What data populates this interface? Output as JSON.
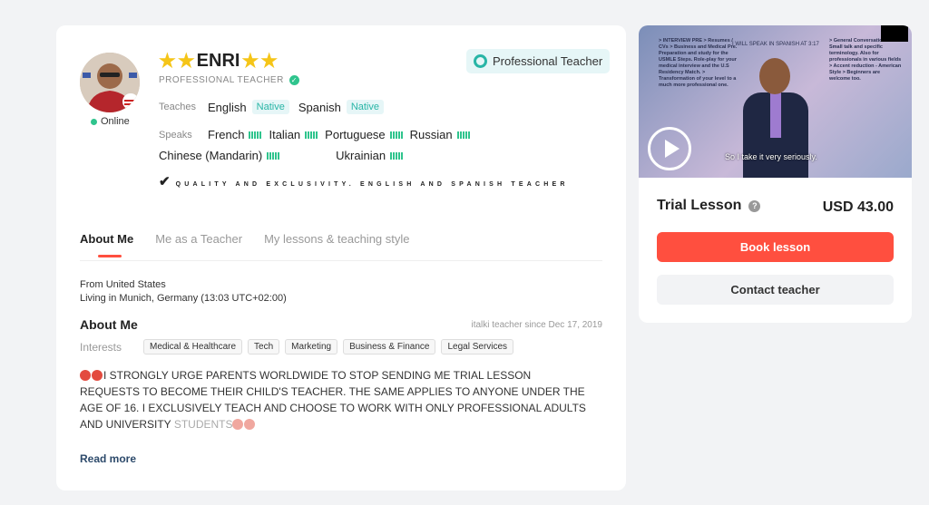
{
  "teacher": {
    "name": "ENRI",
    "role": "PROFESSIONAL TEACHER",
    "status": "Online",
    "badge": "Professional Teacher",
    "tagline": "QUALITY AND EXCLUSIVITY. ENGLISH AND SPANISH TEACHER"
  },
  "teaches": {
    "label": "Teaches",
    "languages": [
      {
        "name": "English",
        "level": "Native"
      },
      {
        "name": "Spanish",
        "level": "Native"
      }
    ]
  },
  "speaks": {
    "label": "Speaks",
    "languages": [
      "French",
      "Italian",
      "Portuguese",
      "Russian",
      "Chinese (Mandarin)",
      "Ukrainian"
    ]
  },
  "tabs": [
    "About Me",
    "Me as a Teacher",
    "My lessons & teaching style"
  ],
  "about": {
    "from": "From United States",
    "living": "Living in Munich, Germany (13:03 UTC+02:00)",
    "title": "About Me",
    "since": "italki teacher since Dec 17, 2019",
    "interests_label": "Interests",
    "interests": [
      "Medical & Healthcare",
      "Tech",
      "Marketing",
      "Business & Finance",
      "Legal Services"
    ],
    "bio": "I STRONGLY URGE PARENTS WORLDWIDE TO STOP SENDING ME TRIAL LESSON REQUESTS TO BECOME THEIR CHILD'S TEACHER. THE SAME APPLIES TO ANYONE UNDER THE AGE OF 16. I EXCLUSIVELY TEACH AND CHOOSE TO WORK WITH ONLY PROFESSIONAL ADULTS AND UNIVERSITY",
    "bio_fade": "STUDENTS",
    "read_more": "Read more"
  },
  "video": {
    "caption": "So I take it very seriously.",
    "left_text": "> INTERVIEW PRE > Resumes / CVs > Business and Medical Pre. Preparation and study for the USMLE Steps. Role-play for your medical interview and the U.S Residency Match. > Transformation of your level to a much more professional one.",
    "right_text": "> General Conversations. > Small talk and specific terminology. Also for professionals in various fields > Accent reduction - American Style > Beginners are welcome too.",
    "top_text": "I WILL SPEAK IN SPANISH AT 3:17"
  },
  "pricing": {
    "label": "Trial Lesson",
    "price": "USD 43.00",
    "book_label": "Book lesson",
    "contact_label": "Contact teacher"
  },
  "colors": {
    "accent": "#ff4f3f",
    "teal": "#28b5a6",
    "green": "#2fc48d"
  }
}
